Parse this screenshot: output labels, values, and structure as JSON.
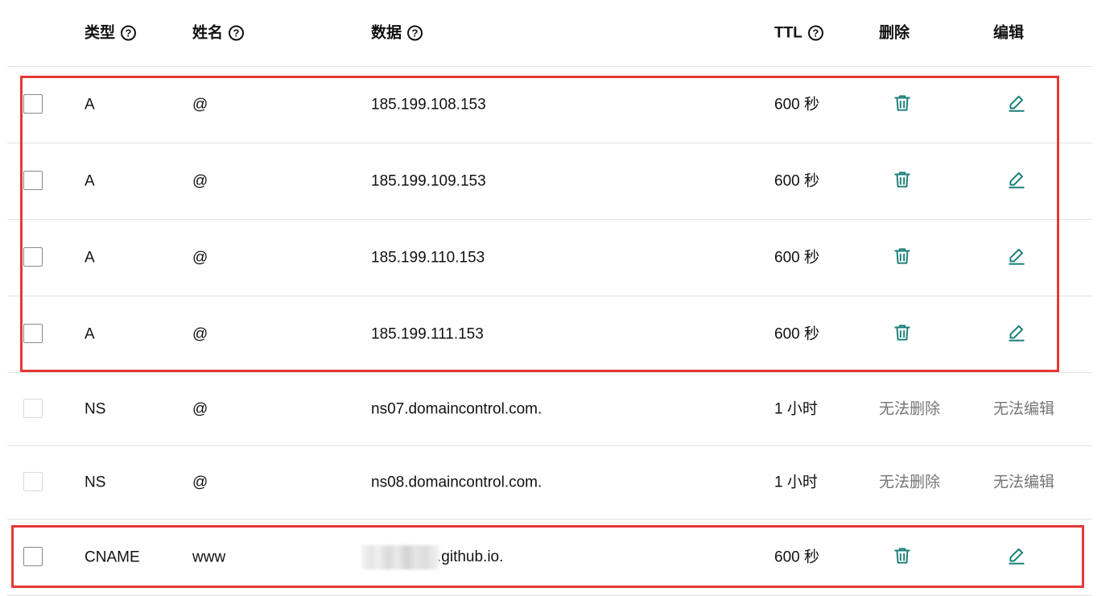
{
  "columns": {
    "type": "类型",
    "name": "姓名",
    "data": "数据",
    "ttl": "TTL",
    "delete": "删除",
    "edit": "编辑"
  },
  "help_glyph": "?",
  "records": [
    {
      "type": "A",
      "name": "@",
      "data": "185.199.108.153",
      "ttl": "600 秒",
      "editable": true
    },
    {
      "type": "A",
      "name": "@",
      "data": "185.199.109.153",
      "ttl": "600 秒",
      "editable": true
    },
    {
      "type": "A",
      "name": "@",
      "data": "185.199.110.153",
      "ttl": "600 秒",
      "editable": true
    },
    {
      "type": "A",
      "name": "@",
      "data": "185.199.111.153",
      "ttl": "600 秒",
      "editable": true
    },
    {
      "type": "NS",
      "name": "@",
      "data": "ns07.domaincontrol.com.",
      "ttl": "1 小时",
      "editable": false,
      "delete_text": "无法删除",
      "edit_text": "无法编辑"
    },
    {
      "type": "NS",
      "name": "@",
      "data": "ns08.domaincontrol.com.",
      "ttl": "1 小时",
      "editable": false,
      "delete_text": "无法删除",
      "edit_text": "无法编辑"
    },
    {
      "type": "CNAME",
      "name": "www",
      "data": ".github.io.",
      "data_obscured_prefix": true,
      "ttl": "600 秒",
      "editable": true
    }
  ],
  "icons": {
    "delete": "trash-icon",
    "edit": "pencil-icon",
    "help": "question-circle-icon"
  },
  "colors": {
    "action_icon": "#1a7f7a",
    "highlight_border": "#e53935",
    "disabled_text": "#767676",
    "row_divider": "#e2e2e2"
  }
}
